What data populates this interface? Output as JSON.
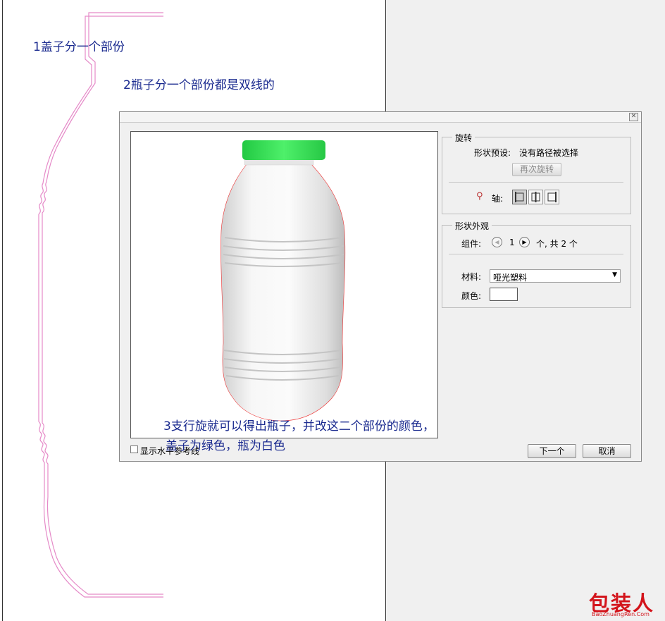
{
  "annotations": {
    "note1": "1盖子分一个部份",
    "note2": "2瓶子分一个部份都是双线的",
    "note3_line1": "3支行旋就可以得出瓶子，并改这二个部份的颜色，",
    "note3_line2": "盖子为绿色，瓶为白色"
  },
  "dialog": {
    "rotate_group": {
      "title": "旋转",
      "preset_label": "形状预设:",
      "preset_value": "没有路径被选择",
      "rerotate_button": "再次旋转",
      "axis_label": "轴:"
    },
    "appearance_group": {
      "title": "形状外观",
      "component_label": "组件:",
      "component_index": "1",
      "component_total": "个, 共 2 个",
      "material_label": "材料:",
      "material_value": "哑光塑料",
      "color_label": "颜色:"
    },
    "show_guides_label": "显示水平参考线",
    "next_button": "下一个",
    "cancel_button": "取消"
  },
  "colors": {
    "cap": "#3be35a",
    "bottle": "#ececec",
    "annotation": "#1a2a8f",
    "profile_line": "#e58ac8",
    "watermark": "#d3141b"
  },
  "watermark": {
    "logo": "包装人",
    "url": "BaoZhuangRen.Com"
  }
}
